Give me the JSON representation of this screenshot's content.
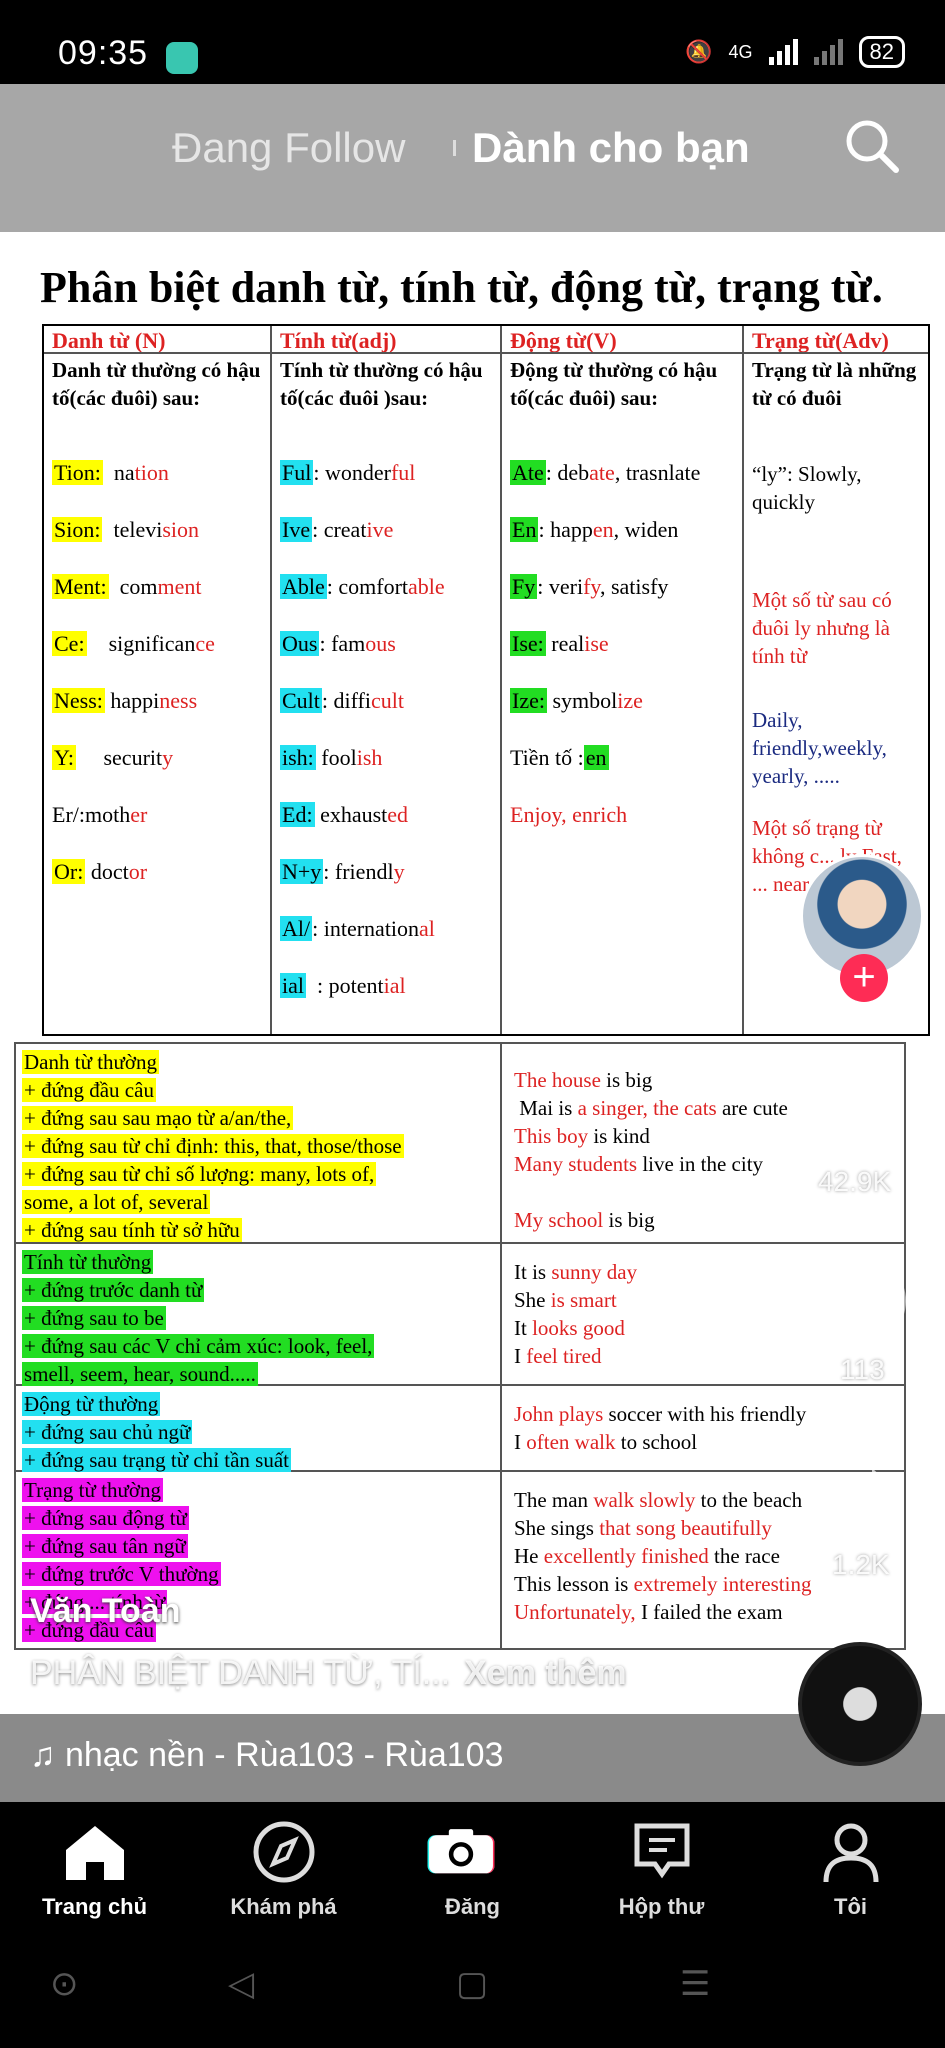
{
  "status": {
    "time": "09:35",
    "network": "4G",
    "battery": "82"
  },
  "nav": {
    "following": "Đang Follow",
    "for_you": "Dành cho bạn"
  },
  "doc": {
    "title": "Phân biệt danh từ, tính từ, động từ, trạng từ.",
    "columns": [
      {
        "header": "Danh từ (N)",
        "intro": "Danh từ thường có hậu tố(các đuôi) sau:",
        "entries": [
          {
            "suffix": "Tion:",
            "rest": "  na",
            "red": "tion",
            "after": ""
          },
          {
            "suffix": "Sion:",
            "rest": "  televi",
            "red": "sion",
            "after": ""
          },
          {
            "suffix": "Ment:",
            "rest": "  com",
            "red": "ment",
            "after": ""
          },
          {
            "suffix": "Ce:",
            "rest": "    significan",
            "red": "ce",
            "after": ""
          },
          {
            "suffix": "Ness:",
            "rest": " happi",
            "red": "ness",
            "after": ""
          },
          {
            "suffix": "Y:",
            "rest": "     securit",
            "red": "y",
            "after": ""
          },
          {
            "suffix": "",
            "rest": "Er/:moth",
            "red": "er",
            "after": ""
          },
          {
            "suffix": "Or:",
            "rest": " doct",
            "red": "or",
            "after": ""
          }
        ]
      },
      {
        "header": "Tính từ(adj)",
        "intro": "Tính từ thường có hậu tố(các đuôi )sau:",
        "entries": [
          {
            "suffix": "Ful",
            "rest": ": wonder",
            "red": "ful",
            "after": ""
          },
          {
            "suffix": "Ive",
            "rest": ": creat",
            "red": "ive",
            "after": ""
          },
          {
            "suffix": "Able",
            "rest": ": comfort",
            "red": "able",
            "after": ""
          },
          {
            "suffix": "Ous",
            "rest": ": fam",
            "red": "ous",
            "after": ""
          },
          {
            "suffix": "Cult",
            "rest": ": diffi",
            "red": "cult",
            "after": ""
          },
          {
            "suffix": "ish:",
            "rest": " fool",
            "red": "ish",
            "after": ""
          },
          {
            "suffix": "Ed:",
            "rest": " exhaust",
            "red": "ed",
            "after": ""
          },
          {
            "suffix": "N+y",
            "rest": ": friendl",
            "red": "y",
            "after": ""
          },
          {
            "suffix": "Al/",
            "rest": ": internation",
            "red": "al",
            "after": ""
          },
          {
            "suffix": "ial",
            "rest": "  : potent",
            "red": "ial",
            "after": ""
          }
        ]
      },
      {
        "header": "Động từ(V)",
        "intro": "Động từ thường có hậu tố(các đuôi) sau:",
        "entries": [
          {
            "suffix": "Ate",
            "rest": ": deb",
            "red": "ate",
            "after": ", trasnlate"
          },
          {
            "suffix": "En",
            "rest": ": happ",
            "red": "en",
            "after": ", widen"
          },
          {
            "suffix": "Fy",
            "rest": ": veri",
            "red": "fy",
            "after": ", satisfy"
          },
          {
            "suffix": "Ise:",
            "rest": " real",
            "red": "ise",
            "after": ""
          },
          {
            "suffix": "Ize:",
            "rest": " symbol",
            "red": "ize",
            "after": ""
          },
          {
            "suffix": "",
            "rest": "Tiền tố :",
            "red": "",
            "after": "",
            "tail_hl": "en"
          },
          {
            "suffix": "",
            "rest": "",
            "red": "Enjoy, enrich",
            "after": ""
          }
        ]
      },
      {
        "header": "Trạng từ(Adv)",
        "intro": "Trạng từ là những từ có đuôi",
        "notes": [
          {
            "text": "“ly”: Slowly, quickly",
            "color": "#000",
            "red_prefix": "“ly”"
          },
          {
            "text": "Một số từ sau có đuôi ly nhưng là tính từ",
            "color": "#d22"
          },
          {
            "text": "Daily, friendly,weekly, yearly, .....",
            "color": "#1a2a80"
          },
          {
            "text": "Một số trạng từ không c... ly Fast, ... near...",
            "color": "#d22"
          }
        ]
      }
    ],
    "usage": [
      {
        "color": "#ffff00",
        "left": [
          "Danh từ thường",
          "+ đứng đầu câu",
          "+ đứng sau sau mạo từ a/an/the,",
          "+ đứng sau từ chỉ định: this, that, those/those",
          "+ đứng sau từ chỉ số lượng: many, lots of,",
          "some, a lot of, several",
          "+ đứng sau tính từ sở hữu"
        ],
        "right": [
          [
            {
              "t": "The house",
              "r": true
            },
            {
              "t": " is big",
              "r": false
            }
          ],
          [
            {
              "t": " Mai is ",
              "r": false
            },
            {
              "t": "a singer, the cats",
              "r": true
            },
            {
              "t": " are cute",
              "r": false
            }
          ],
          [
            {
              "t": "This boy",
              "r": true
            },
            {
              "t": " is kind",
              "r": false
            }
          ],
          [
            {
              "t": "Many students",
              "r": true
            },
            {
              "t": " live in the city",
              "r": false
            }
          ],
          [
            {
              "t": "",
              "r": false
            }
          ],
          [
            {
              "t": "My school",
              "r": true
            },
            {
              "t": " is big",
              "r": false
            }
          ]
        ]
      },
      {
        "color": "#22dd22",
        "left": [
          "Tính từ thường",
          "+ đứng trước danh từ",
          "+ đứng sau to be",
          "+ đứng sau các V chỉ cảm xúc: look, feel,",
          "smell, seem, hear, sound....."
        ],
        "right": [
          [
            {
              "t": "It is ",
              "r": false
            },
            {
              "t": "sunny day",
              "r": true
            }
          ],
          [
            {
              "t": "She ",
              "r": false
            },
            {
              "t": "is smart",
              "r": true
            }
          ],
          [
            {
              "t": "It ",
              "r": false
            },
            {
              "t": "looks good",
              "r": true
            }
          ],
          [
            {
              "t": "I ",
              "r": false
            },
            {
              "t": "feel tired",
              "r": true
            }
          ]
        ]
      },
      {
        "color": "#22e0f0",
        "left": [
          "Động từ thường",
          "+  đứng sau chủ ngữ",
          "+ đứng sau trạng từ chỉ tần suất"
        ],
        "right": [
          [
            {
              "t": "John plays",
              "r": true
            },
            {
              "t": " soccer with his friendly",
              "r": false
            }
          ],
          [
            {
              "t": "I ",
              "r": false
            },
            {
              "t": "often walk",
              "r": true
            },
            {
              "t": " to school",
              "r": false
            }
          ]
        ]
      },
      {
        "color": "#ee11ee",
        "left": [
          "Trạng từ thường",
          "+ đứng sau  động từ",
          "+ đứng sau tân ngữ",
          "+ đứng trước V thường",
          "+ đứng ... tính từ",
          "+ đứng đầu câu"
        ],
        "right": [
          [
            {
              "t": "The man ",
              "r": false
            },
            {
              "t": "walk slowly",
              "r": true
            },
            {
              "t": " to the beach",
              "r": false
            }
          ],
          [
            {
              "t": "She sings ",
              "r": false
            },
            {
              "t": "that song beautifully",
              "r": true
            }
          ],
          [
            {
              "t": "He ",
              "r": false
            },
            {
              "t": "excellently finished",
              "r": true
            },
            {
              "t": " the race",
              "r": false
            }
          ],
          [
            {
              "t": "This lesson is ",
              "r": false
            },
            {
              "t": "extremely interesting",
              "r": true
            }
          ],
          [
            {
              "t": "Unfortunately,",
              "r": true
            },
            {
              "t": " I failed the exam",
              "r": false
            }
          ]
        ]
      }
    ]
  },
  "side": {
    "likes": "42.9K",
    "comments": "113",
    "shares": "1.2K"
  },
  "post": {
    "author": "Văn Toàn",
    "caption": "PHÂN BIỆT DANH TỪ, TÍ...",
    "more": "Xem thêm",
    "music": "♫ nhạc nền - Rùa103 - Rùa103"
  },
  "tabs": [
    {
      "label": "Trang chủ",
      "icon": "home-icon"
    },
    {
      "label": "Khám phá",
      "icon": "compass-icon"
    },
    {
      "label": "Đăng",
      "icon": "camera-icon"
    },
    {
      "label": "Hộp thư",
      "icon": "inbox-icon"
    },
    {
      "label": "Tôi",
      "icon": "profile-icon"
    }
  ],
  "colors": {
    "yellow": "#ffff00",
    "cyan": "#22e0f0",
    "green": "#22dd22",
    "magenta": "#ee11ee",
    "red": "#d22222",
    "accent": "#fe2c55"
  }
}
